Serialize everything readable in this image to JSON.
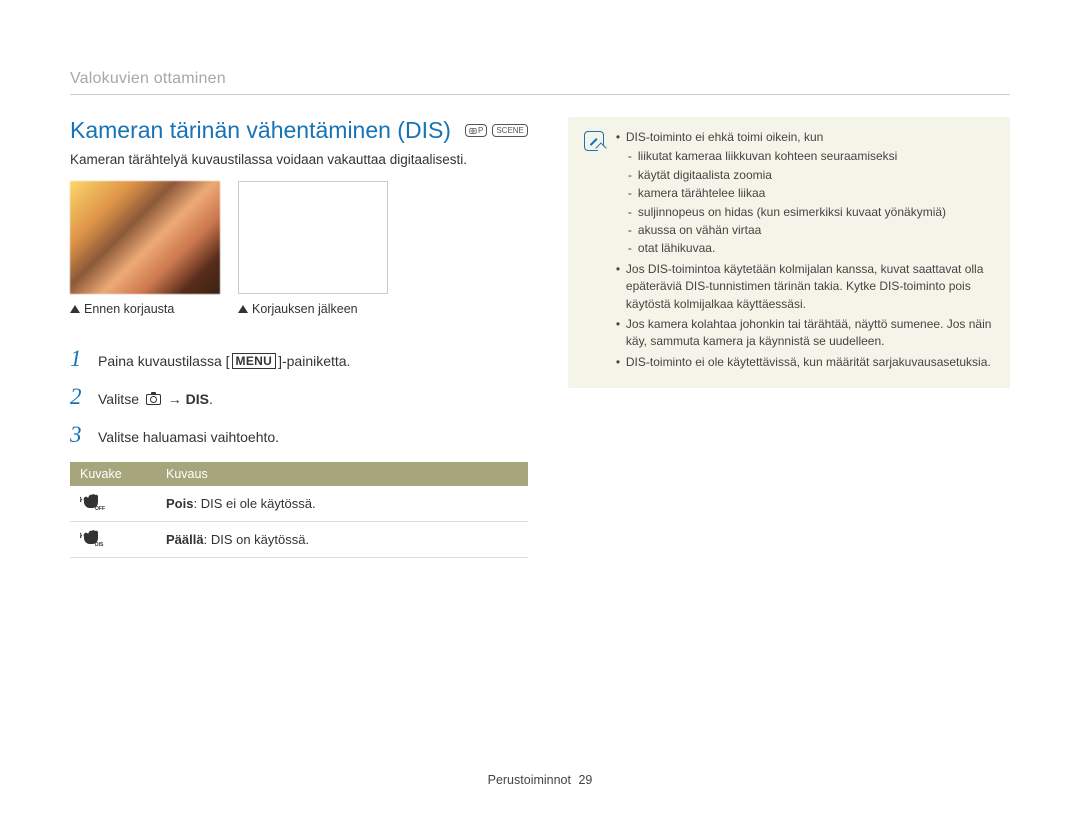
{
  "breadcrumb": "Valokuvien ottaminen",
  "title": "Kameran tärinän vähentäminen (DIS)",
  "mode_icons": {
    "program": "P",
    "scene": "SCENE"
  },
  "intro": "Kameran tärähtelyä kuvaustilassa voidaan vakauttaa digitaalisesti.",
  "captions": {
    "before": "Ennen korjausta",
    "after": "Korjauksen jälkeen"
  },
  "steps": [
    {
      "num": "1",
      "pre": "Paina kuvaustilassa [",
      "btn": "MENU",
      "post": "]-painiketta."
    },
    {
      "num": "2",
      "pre": "Valitse ",
      "arrow": " → ",
      "bold": "DIS",
      "post": "."
    },
    {
      "num": "3",
      "text": "Valitse haluamasi vaihtoehto."
    }
  ],
  "table": {
    "headers": {
      "icon": "Kuvake",
      "desc": "Kuvaus"
    },
    "rows": [
      {
        "icon_sub": "OFF",
        "label": "Pois",
        "text": ": DIS ei ole käytössä."
      },
      {
        "icon_sub": "DIS",
        "label": "Päällä",
        "text": ": DIS on käytössä."
      }
    ]
  },
  "notes": [
    {
      "text": "DIS-toiminto ei ehkä toimi oikein, kun",
      "sub": [
        "liikutat kameraa liikkuvan kohteen seuraamiseksi",
        "käytät digitaalista zoomia",
        "kamera tärähtelee liikaa",
        "suljinnopeus on hidas (kun esimerkiksi kuvaat yönäkymiä)",
        "akussa on vähän virtaa",
        "otat lähikuvaa."
      ]
    },
    {
      "text": "Jos DIS-toimintoa käytetään kolmijalan kanssa, kuvat saattavat olla epäteräviä DIS-tunnistimen tärinän takia. Kytke DIS-toiminto pois käytöstä kolmijalkaa käyttäessäsi."
    },
    {
      "text": "Jos kamera kolahtaa johonkin tai tärähtää, näyttö sumenee. Jos näin käy, sammuta kamera ja käynnistä se uudelleen."
    },
    {
      "text": "DIS-toiminto ei ole käytettävissä, kun määrität sarjakuvausasetuksia."
    }
  ],
  "footer": {
    "section": "Perustoiminnot",
    "page": "29"
  }
}
